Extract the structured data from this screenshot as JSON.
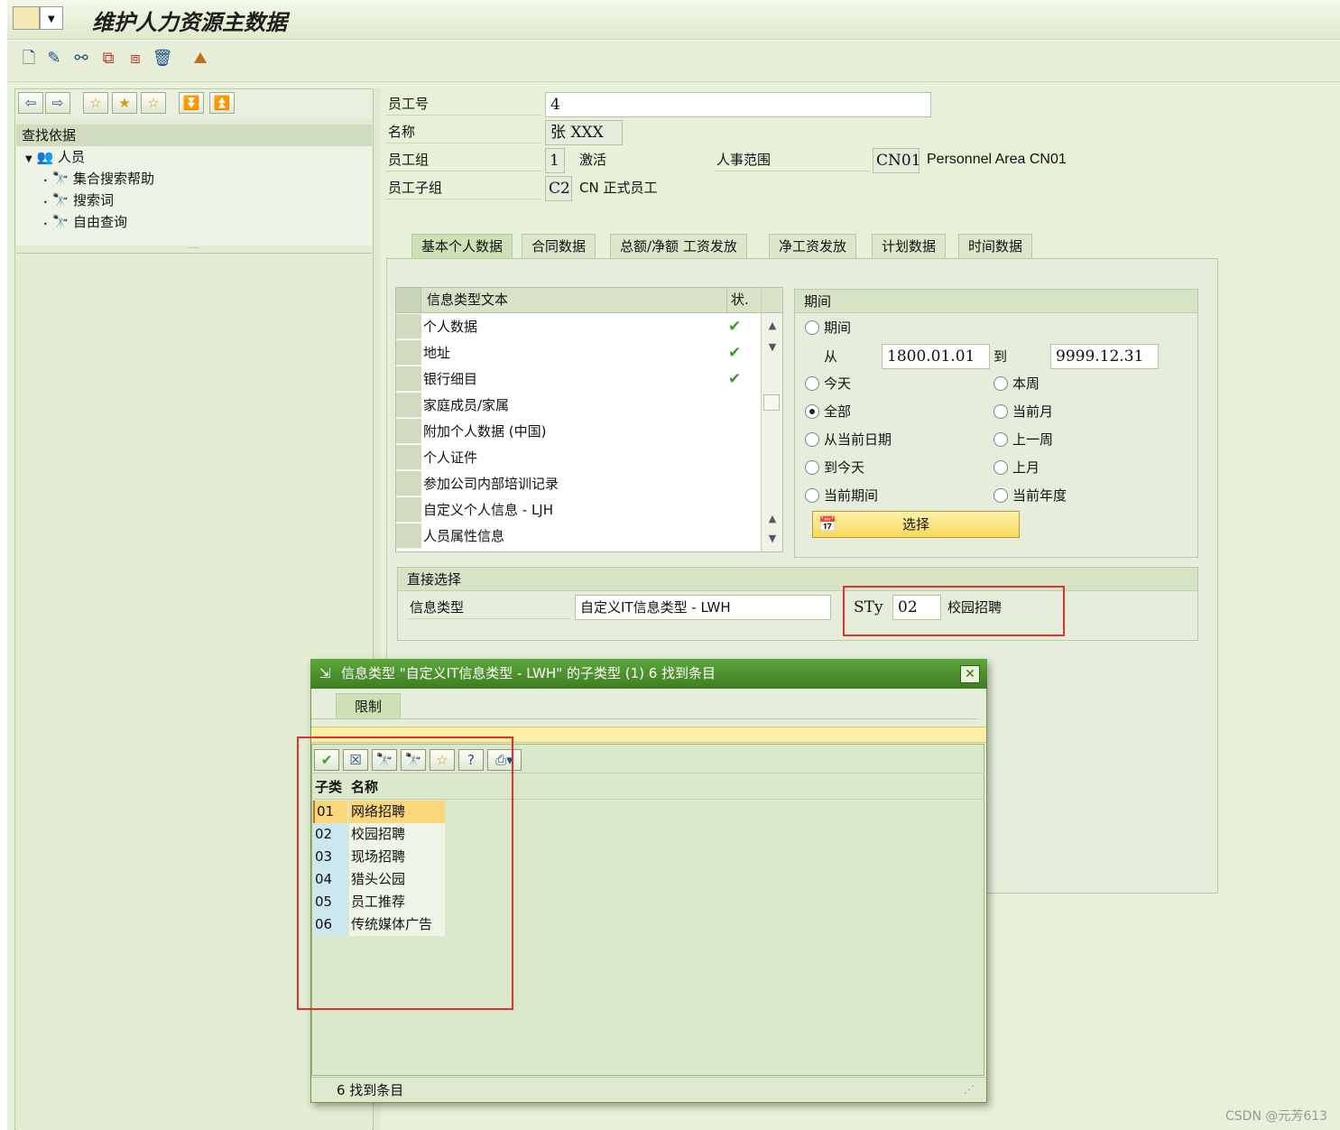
{
  "window": {
    "title": "维护人力资源主数据"
  },
  "toolbar": {
    "icons": [
      "new-icon",
      "edit-icon",
      "display-icon",
      "copy-icon",
      "delimit-icon",
      "delete-icon",
      "overview-icon"
    ]
  },
  "left_pane": {
    "header": "查找依据",
    "tree": {
      "root": "人员",
      "items": [
        "集合搜索帮助",
        "搜索词",
        "自由查询"
      ]
    }
  },
  "employee": {
    "id_label": "员工号",
    "id_value": "4",
    "name_label": "名称",
    "name_value": "张 XXX",
    "group_label": "员工组",
    "group_code": "1",
    "group_text": "激活",
    "area_label": "人事范围",
    "area_code": "CN01",
    "area_text": "Personnel Area CN01",
    "subgroup_label": "员工子组",
    "subgroup_code": "C2",
    "subgroup_text": "CN 正式员工"
  },
  "tabs": [
    {
      "label": "基本个人数据",
      "active": true
    },
    {
      "label": "合同数据"
    },
    {
      "label": "总额/净额 工资发放"
    },
    {
      "label": "净工资发放"
    },
    {
      "label": "计划数据"
    },
    {
      "label": "时间数据"
    }
  ],
  "infotype_grid": {
    "col_text": "信息类型文本",
    "col_status": "状.",
    "rows": [
      {
        "text": "个人数据",
        "status": "✔"
      },
      {
        "text": "地址",
        "status": "✔"
      },
      {
        "text": "银行细目",
        "status": "✔"
      },
      {
        "text": "家庭成员/家属",
        "status": ""
      },
      {
        "text": "附加个人数据 (中国)",
        "status": ""
      },
      {
        "text": "个人证件",
        "status": ""
      },
      {
        "text": "参加公司内部培训记录",
        "status": ""
      },
      {
        "text": "自定义个人信息 - LJH",
        "status": ""
      },
      {
        "text": "人员属性信息",
        "status": ""
      }
    ]
  },
  "period": {
    "title": "期间",
    "opt_period": "期间",
    "from_label": "从",
    "from_value": "1800.01.01",
    "to_label": "到",
    "to_value": "9999.12.31",
    "opt_today": "今天",
    "opt_week": "本周",
    "opt_all": "全部",
    "opt_month": "当前月",
    "opt_from_today": "从当前日期",
    "opt_last_week": "上一周",
    "opt_to_today": "到今天",
    "opt_last_month": "上月",
    "opt_current_period": "当前期间",
    "opt_current_year": "当前年度",
    "select_button": "选择"
  },
  "direct": {
    "title": "直接选择",
    "infotype_label": "信息类型",
    "infotype_value": "自定义IT信息类型 - LWH",
    "sty_label": "STy",
    "sty_value": "02",
    "sty_text": "校园招聘"
  },
  "dialog": {
    "title": "信息类型 \"自定义IT信息类型 - LWH\" 的子类型 (1)   6 找到条目",
    "tab": "限制",
    "col_code": "子类",
    "col_name": "名称",
    "rows": [
      {
        "code": "01",
        "name": "网络招聘"
      },
      {
        "code": "02",
        "name": "校园招聘"
      },
      {
        "code": "03",
        "name": "现场招聘"
      },
      {
        "code": "04",
        "name": "猎头公园"
      },
      {
        "code": "05",
        "name": "员工推荐"
      },
      {
        "code": "06",
        "name": "传统媒体广告"
      }
    ],
    "status": "6 找到条目"
  },
  "watermark": "CSDN @元芳613"
}
